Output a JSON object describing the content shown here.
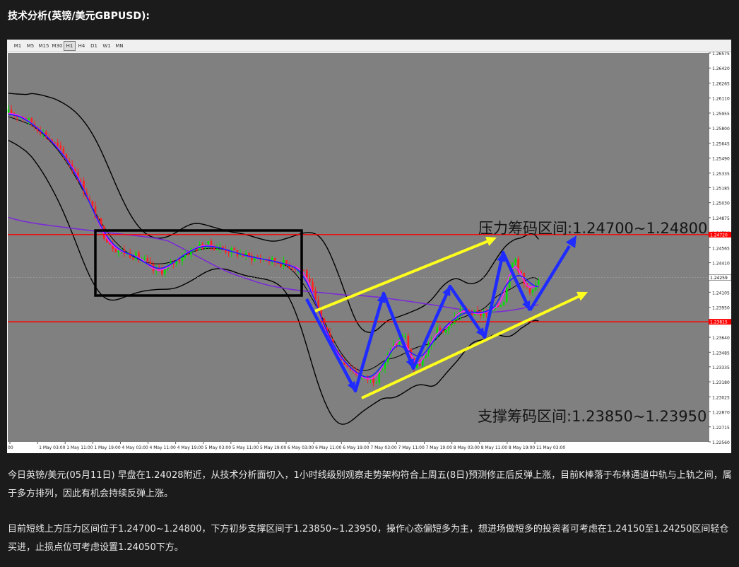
{
  "page": {
    "title": "技术分析(英镑/美元GBPUSD):"
  },
  "toolbar": {
    "timeframes": [
      "M1",
      "M5",
      "M15",
      "M30",
      "H1",
      "H4",
      "D1",
      "W1",
      "MN"
    ],
    "active": "H1"
  },
  "colors": {
    "background": "#1b1b1b",
    "plot_bg": "#808080",
    "resistance_line": "#ff0000",
    "arrow_blue": "#1f2bff",
    "arrow_yellow": "#ffff1e",
    "box": "#000000",
    "bollinger": "#000000",
    "ma_long": "#7b2bd6",
    "ma_fast_blue": "#2020ff",
    "ma_fast_magenta": "#ff20ff",
    "candle_up": "#00e000",
    "candle_down": "#ff2020"
  },
  "chart_data": {
    "type": "candlestick",
    "symbol": "GBPUSD",
    "timeframe": "H1",
    "y_ticks": [
      "1.26575",
      "1.26420",
      "1.26265",
      "1.26110",
      "1.25955",
      "1.25800",
      "1.25645",
      "1.25490",
      "1.25335",
      "1.25185",
      "1.25030",
      "1.24875",
      "1.24720",
      "1.24565",
      "1.24410",
      "1.24259",
      "1.24105",
      "1.23950",
      "1.23795",
      "1.23640",
      "1.23485",
      "1.23335",
      "1.23180",
      "1.23025",
      "1.22870",
      "1.22715",
      "1.22560"
    ],
    "ylim": [
      1.2256,
      1.26575
    ],
    "current_price_label": "1.24259",
    "resistance_price_label": "1.24720",
    "support_price_label": "1.23815",
    "x_ticks": [
      "00",
      "1 May 03:00",
      "1 May 11:00",
      "1 May 19:00",
      "4 May 03:00",
      "4 May 11:00",
      "4 May 19:00",
      "5 May 03:00",
      "5 May 11:00",
      "5 May 19:00",
      "6 May 03:00",
      "6 May 11:00",
      "6 May 19:00",
      "7 May 03:00",
      "7 May 11:00",
      "7 May 19:00",
      "8 May 03:00",
      "8 May 11:00",
      "8 May 19:00",
      "11 May 03:00"
    ],
    "resistance_level": 1.247,
    "support_level": 1.238,
    "annotations": {
      "resistance": "压力筹码区间:1.24700~1.24800",
      "support": "支撑筹码区间:1.23850~1.23950"
    },
    "grid": false
  },
  "text": {
    "para1": "今日英镑/美元(05月11日) 早盘在1.24028附近，从技术分析面切入，1小时线级别观察走势架构符合上周五(8日)预测修正后反弹上涨，目前K棒落于布林通道中轨与上轨之间，属于多方排列，因此有机会持续反弹上涨。",
    "para2": "目前短线上方压力区间位于1.24700~1.24800，下方初步支撑区间于1.23850~1.23950，操作心态偏短多为主，想进场做短多的投资者可考虑在1.24150至1.24250区间轻仓买进，止损点位可考虑设置1.24050下方。"
  }
}
